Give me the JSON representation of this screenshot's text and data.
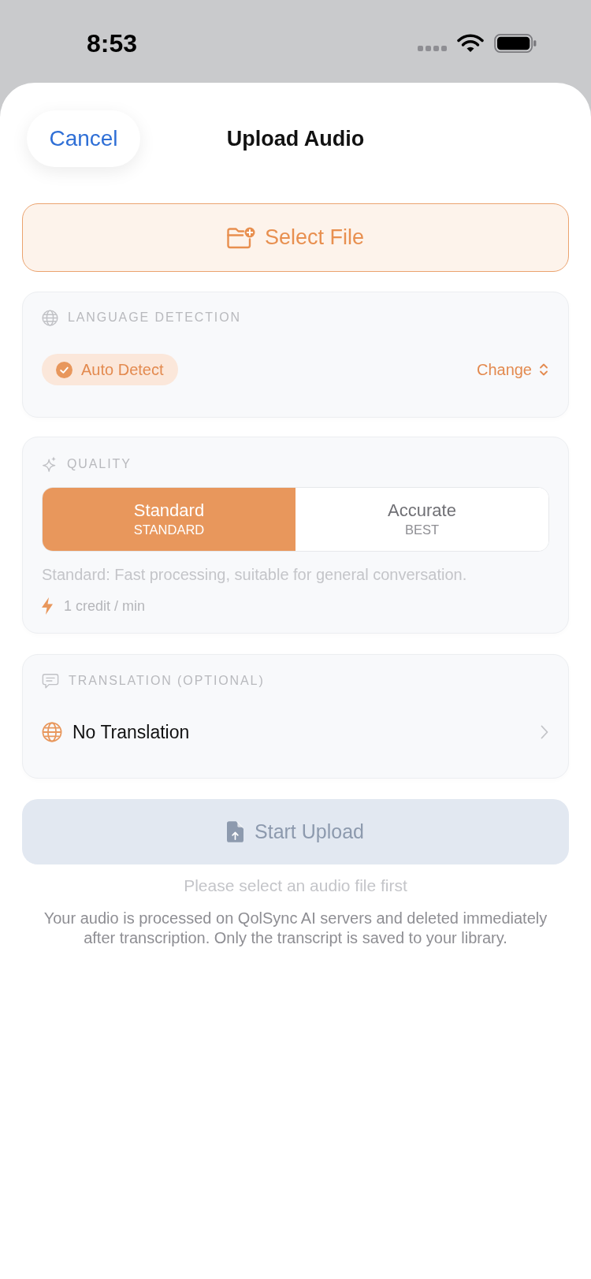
{
  "status_bar": {
    "time": "8:53"
  },
  "header": {
    "cancel": "Cancel",
    "title": "Upload Audio"
  },
  "select_file": {
    "label": "Select File"
  },
  "language": {
    "heading": "LANGUAGE DETECTION",
    "chip": {
      "label": "Auto Detect",
      "checked": true
    },
    "change": "Change"
  },
  "quality": {
    "heading": "QUALITY",
    "options": [
      {
        "label": "Standard",
        "sublabel": "STANDARD",
        "selected": true
      },
      {
        "label": "Accurate",
        "sublabel": "BEST",
        "selected": false
      }
    ],
    "description": "Standard: Fast processing, suitable for general conversation.",
    "cost": "1 credit / min"
  },
  "translation": {
    "heading": "TRANSLATION (OPTIONAL)",
    "value": "No Translation"
  },
  "start_upload": {
    "label": "Start Upload",
    "disabled": true
  },
  "hint": "Please select an audio file first",
  "privacy_note": "Your audio is processed on QolSync AI servers and deleted immediately after transcription. Only the transcript is saved to your library."
}
